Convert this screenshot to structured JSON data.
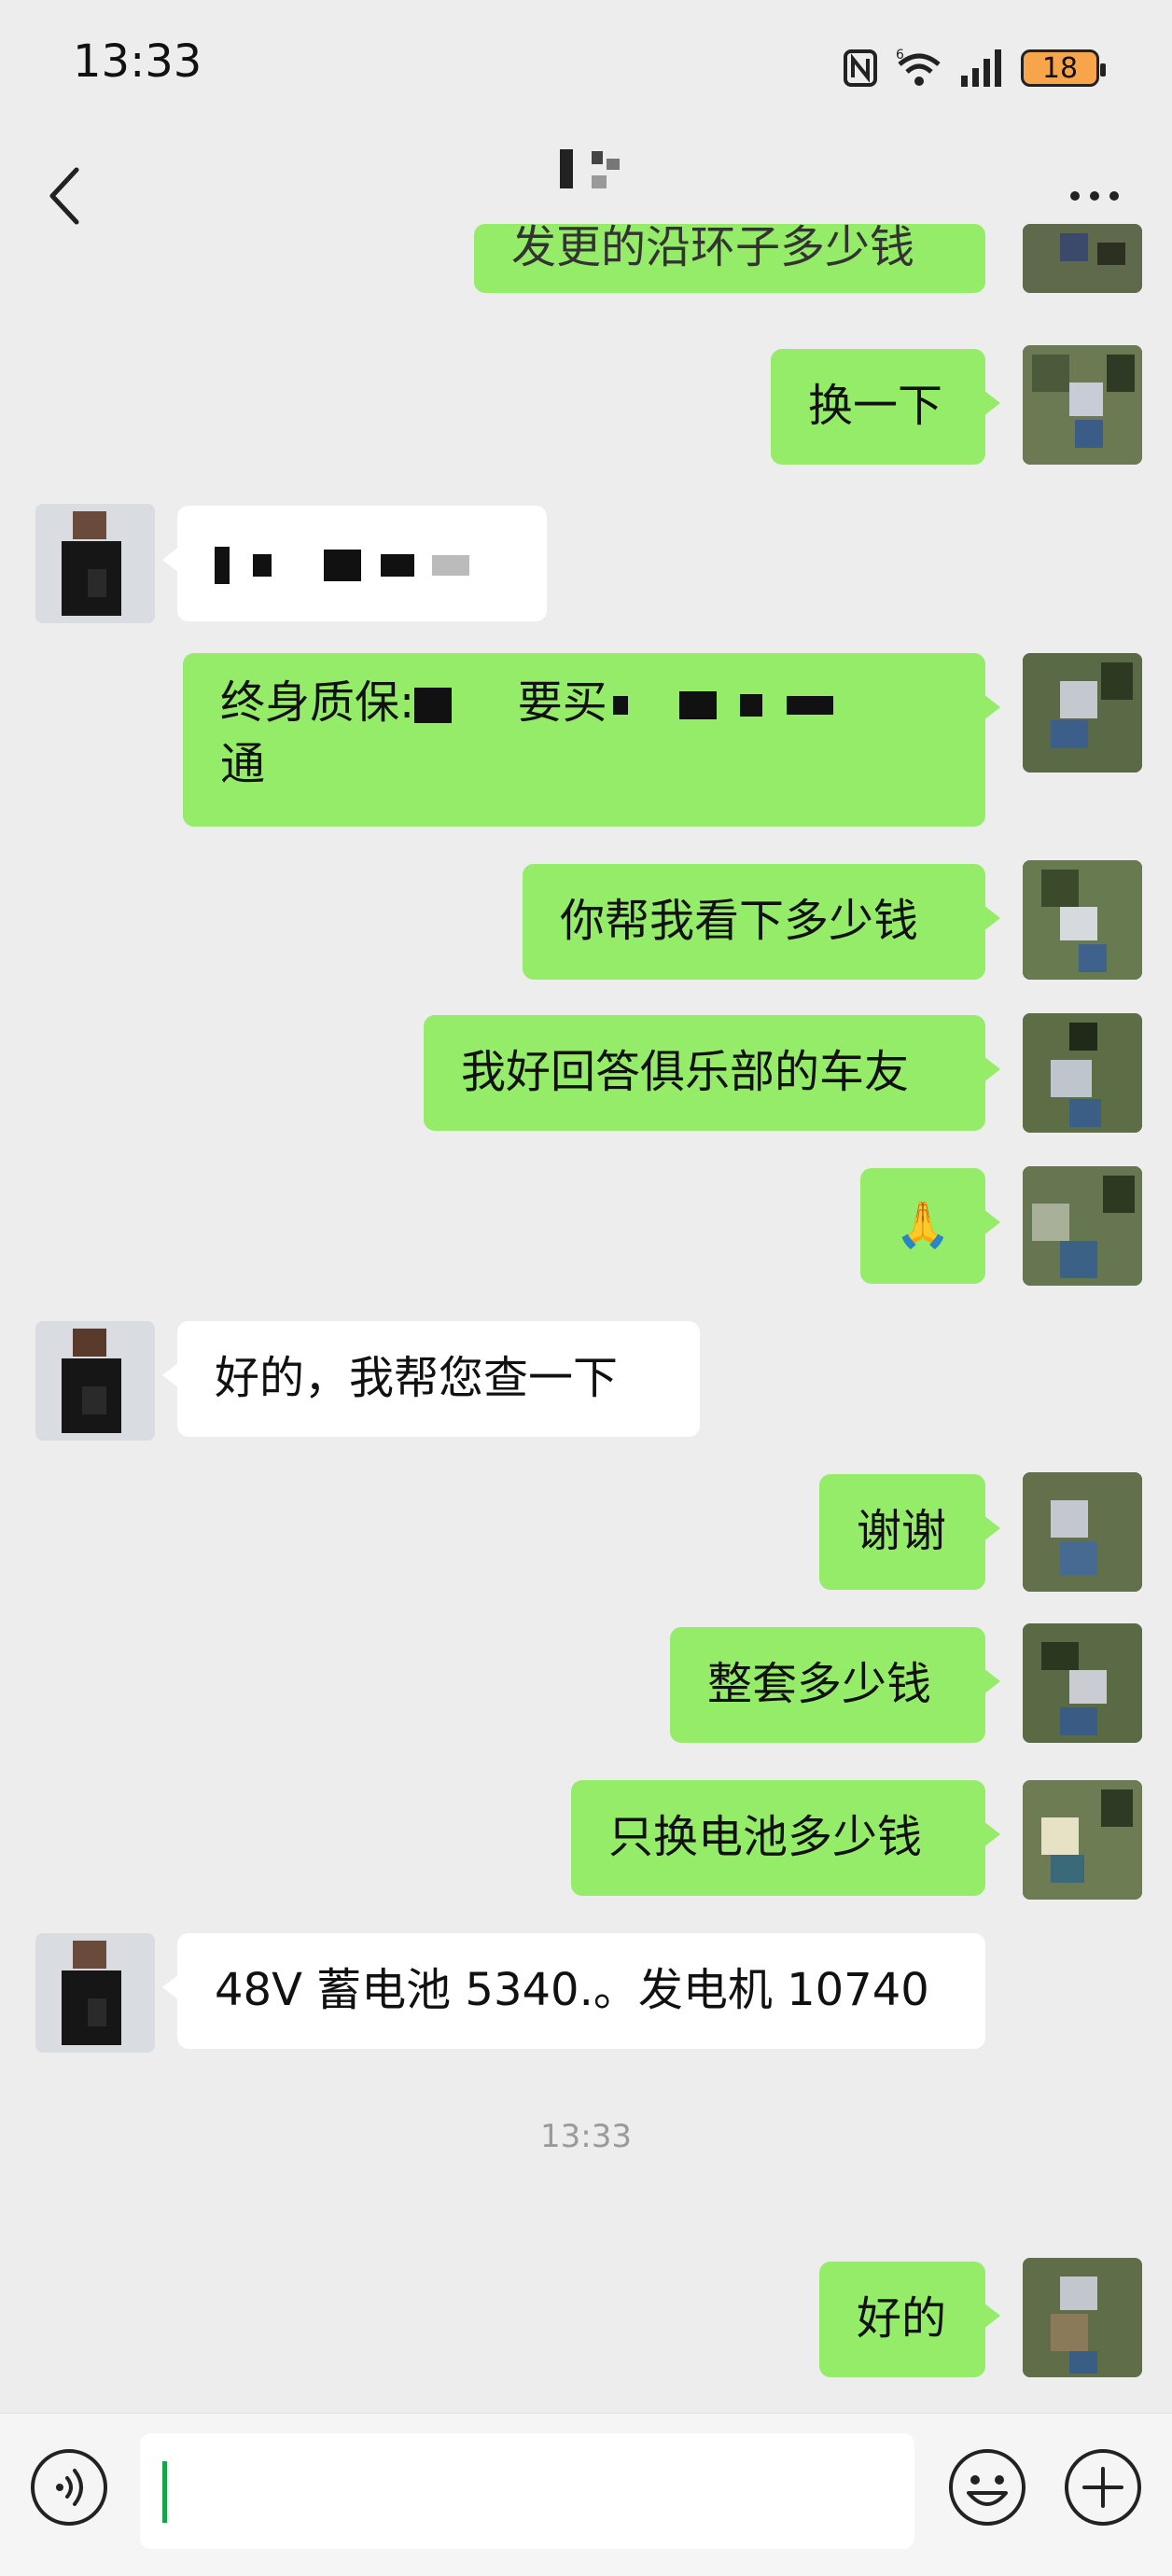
{
  "status_bar": {
    "time": "13:33",
    "battery": "18",
    "network_label": "6"
  },
  "header": {
    "title": "",
    "subtitle": "",
    "back_icon": "chevron-left-icon",
    "more_icon": "more-horizontal-icon"
  },
  "messages": [
    {
      "side": "me",
      "text": "发更的沿环子多少钱",
      "partial": true
    },
    {
      "side": "me",
      "text": "换一下"
    },
    {
      "side": "other",
      "text": ""
    },
    {
      "side": "me",
      "line1_a": "终身质保:",
      "line1_b": "要买",
      "line2": "通"
    },
    {
      "side": "me",
      "text": "你帮我看下多少钱"
    },
    {
      "side": "me",
      "text": "我好回答俱乐部的车友"
    },
    {
      "side": "me",
      "text": "🙏"
    },
    {
      "side": "other",
      "text": "好的，我帮您查一下"
    },
    {
      "side": "me",
      "text": "谢谢"
    },
    {
      "side": "me",
      "text": "整套多少钱"
    },
    {
      "side": "me",
      "text": "只换电池多少钱"
    },
    {
      "side": "other",
      "text": "48V 蓄电池 5340.。发电机 10740"
    },
    {
      "side": "time",
      "text": "13:33"
    },
    {
      "side": "me",
      "text": "好的"
    }
  ],
  "input_bar": {
    "value": "",
    "voice_icon": "voice-icon",
    "emoji_icon": "emoji-icon",
    "plus_icon": "plus-icon"
  },
  "colors": {
    "background": "#ededed",
    "my_bubble": "#95ec69",
    "other_bubble": "#ffffff",
    "caret": "#19a44a"
  }
}
